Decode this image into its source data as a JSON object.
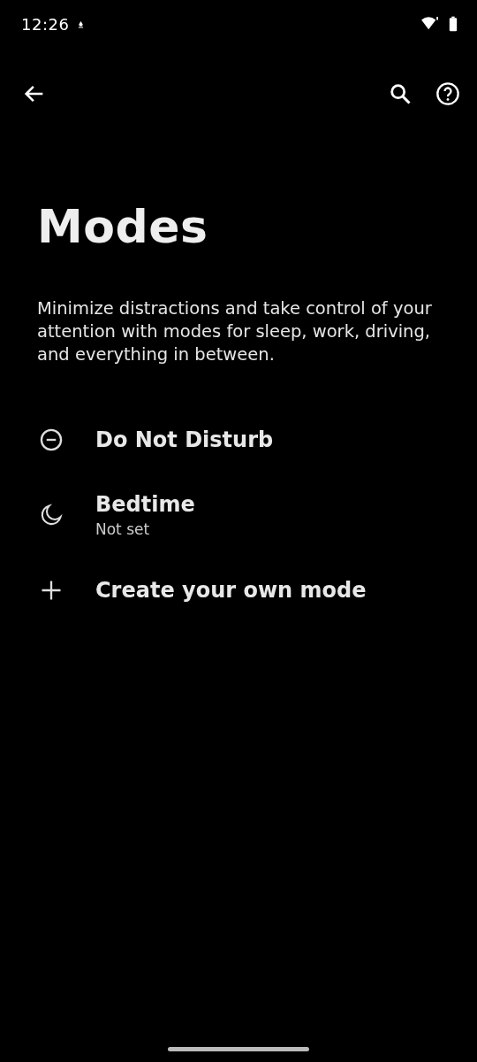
{
  "status_bar": {
    "time": "12:26"
  },
  "title": "Modes",
  "description": "Minimize distractions and take control of your attention with modes for sleep, work, driving, and everything in between.",
  "modes": [
    {
      "kind": "dnd",
      "label": "Do Not Disturb"
    },
    {
      "kind": "bedtime",
      "label": "Bedtime",
      "summary": "Not set"
    },
    {
      "kind": "add",
      "label": "Create your own mode"
    }
  ]
}
